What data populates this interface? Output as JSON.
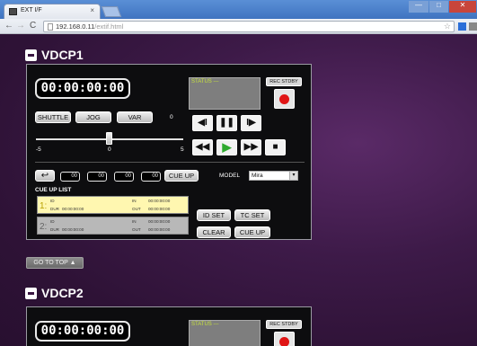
{
  "browser": {
    "tab_title": "EXT I/F",
    "tab_close": "×",
    "url_host": "192.168.0.11",
    "url_path": "/extif.html",
    "back": "←",
    "forward": "→",
    "reload": "C",
    "star": "☆",
    "win_min": "—",
    "win_max": "□",
    "win_close": "✕"
  },
  "sections": [
    {
      "title": "VDCP1",
      "timecode": "00:00:00:00",
      "status_label": "STATUS ---",
      "rec_stdby_label": "REC STDBY",
      "buttons": {
        "shuttle": "SHUTTLE",
        "jog": "JOG",
        "var": "VAR"
      },
      "speed_value": "0",
      "slider": {
        "min": "-5",
        "mid": "0",
        "max": "5",
        "value": 0
      },
      "transport": {
        "step_back": "◀I",
        "pause": "❚❚",
        "step_fwd": "I▶",
        "rewind": "◀◀",
        "play": "▶",
        "ffwd": "▶▶",
        "stop": "■"
      },
      "cue_fields": [
        "00",
        "00",
        "00",
        "00"
      ],
      "cue_up_label": "CUE UP",
      "model_label": "MODEL",
      "model_value": "Mira",
      "cue_list_title": "CUE UP LIST",
      "cue_list": [
        {
          "num": "1:",
          "id_label": "ID",
          "id_value": "",
          "in_label": "IN",
          "in_value": "00:00:00:00",
          "dur_label": "DUR",
          "dur_value": "00:00:00:00",
          "out_label": "OUT",
          "out_value": "00:00:00:00"
        },
        {
          "num": "2:",
          "id_label": "ID",
          "id_value": "",
          "in_label": "IN",
          "in_value": "00:00:00:00",
          "dur_label": "DUR",
          "dur_value": "00:00:00:00",
          "out_label": "OUT",
          "out_value": "00:00:00:00"
        }
      ],
      "list_buttons": {
        "id_set": "ID SET",
        "tc_set": "TC SET",
        "clear": "CLEAR",
        "cue_up": "CUE UP"
      }
    },
    {
      "title": "VDCP2",
      "timecode": "00:00:00:00",
      "status_label": "STATUS ---",
      "rec_stdby_label": "REC STDBY"
    }
  ],
  "go_to_top": "GO TO TOP ▲",
  "colors": {
    "highlight_row": "#fff7b0",
    "normal_row": "#b8b8b8",
    "rec": "#e01515",
    "play": "#2faa2f"
  }
}
